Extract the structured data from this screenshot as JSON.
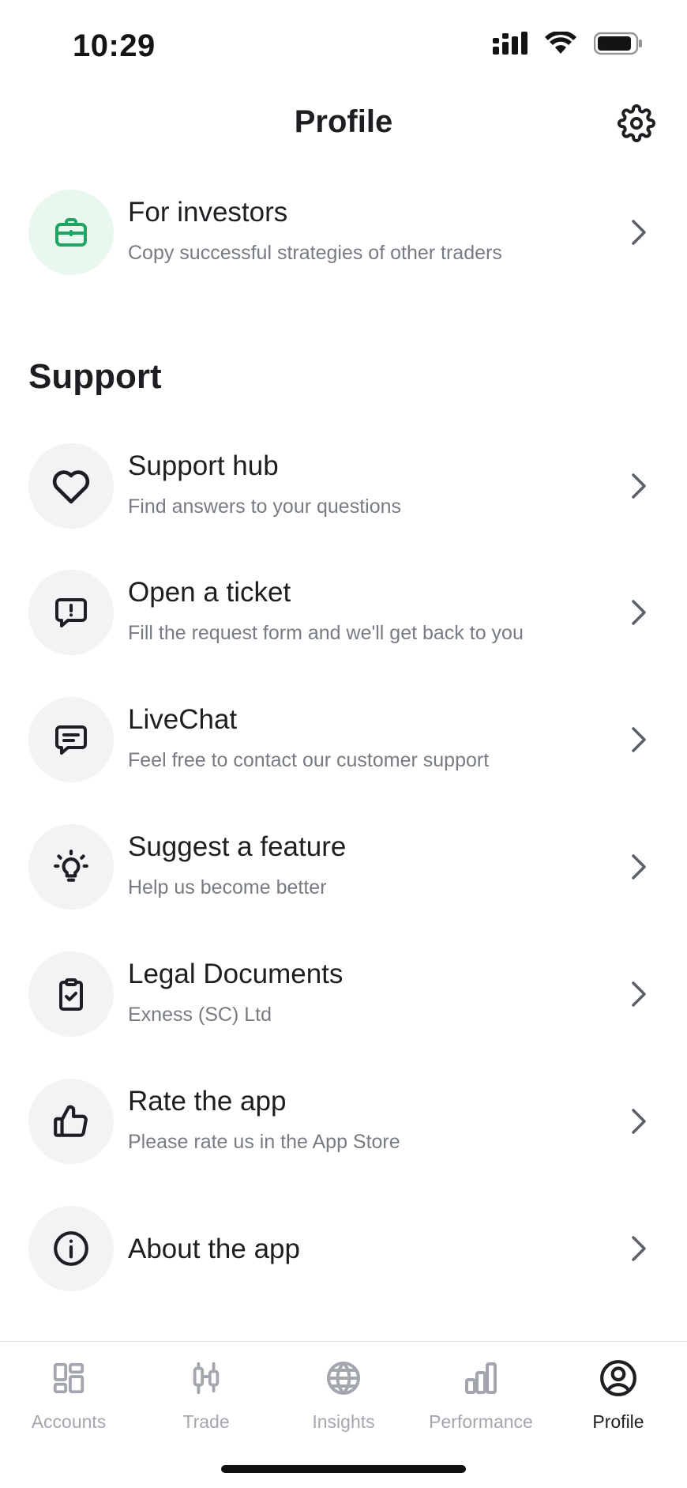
{
  "status_bar": {
    "time": "10:29"
  },
  "header": {
    "title": "Profile"
  },
  "investors": {
    "title": "For investors",
    "subtitle": "Copy successful strategies of other traders"
  },
  "support": {
    "heading": "Support",
    "items": [
      {
        "title": "Support hub",
        "subtitle": "Find answers to your questions",
        "icon": "heart-icon"
      },
      {
        "title": "Open a ticket",
        "subtitle": "Fill the request form and we'll get back to you",
        "icon": "ticket-icon"
      },
      {
        "title": "LiveChat",
        "subtitle": "Feel free to contact our customer support",
        "icon": "chat-icon"
      },
      {
        "title": "Suggest a feature",
        "subtitle": "Help us become better",
        "icon": "lightbulb-icon"
      },
      {
        "title": "Legal Documents",
        "subtitle": "Exness (SC) Ltd",
        "icon": "clipboard-check-icon"
      },
      {
        "title": "Rate the app",
        "subtitle": "Please rate us in the App Store",
        "icon": "thumbs-up-icon"
      },
      {
        "title": "About the app",
        "icon": "info-icon"
      }
    ]
  },
  "tabs": [
    {
      "label": "Accounts",
      "icon": "accounts-icon",
      "active": false
    },
    {
      "label": "Trade",
      "icon": "trade-icon",
      "active": false
    },
    {
      "label": "Insights",
      "icon": "globe-icon",
      "active": false
    },
    {
      "label": "Performance",
      "icon": "bar-chart-icon",
      "active": false
    },
    {
      "label": "Profile",
      "icon": "profile-icon",
      "active": true
    }
  ],
  "colors": {
    "accent_green": "#1fa463",
    "text": "#1c1e22",
    "muted": "#777b82",
    "tab_inactive": "#a3a7ad"
  }
}
